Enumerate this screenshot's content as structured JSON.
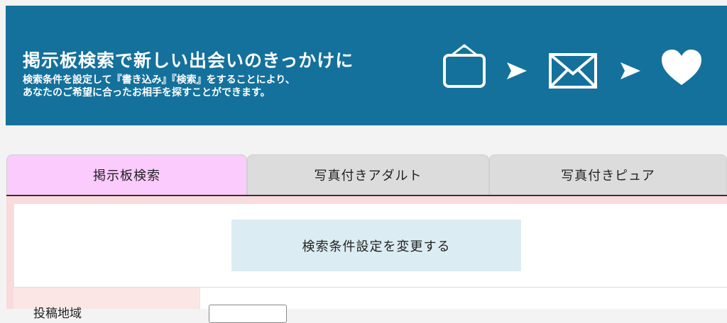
{
  "banner": {
    "title": "掲示板検索で新しい出会いのきっかけに",
    "subtitle_line1": "検索条件を設定して『書き込み』『検索』をすることにより、",
    "subtitle_line2": "あなたのご希望に合ったお相手を探すことができます。",
    "icons": [
      "signboard-icon",
      "arrow-right-icon",
      "envelope-icon",
      "arrow-right-icon",
      "heart-icon"
    ],
    "bg_color": "#14719c"
  },
  "tabs": [
    {
      "label": "掲示板検索",
      "active": true
    },
    {
      "label": "写真付きアダルト",
      "active": false
    },
    {
      "label": "写真付きピュア",
      "active": false
    }
  ],
  "form": {
    "change_button_label": "検索条件設定を変更する",
    "row_label": "投稿地域"
  },
  "colors": {
    "active_tab": "#fbcbfd",
    "inactive_tab": "#dcdcdc",
    "panel_bg": "#f9dbdb",
    "button_bg": "#dcecf3"
  }
}
